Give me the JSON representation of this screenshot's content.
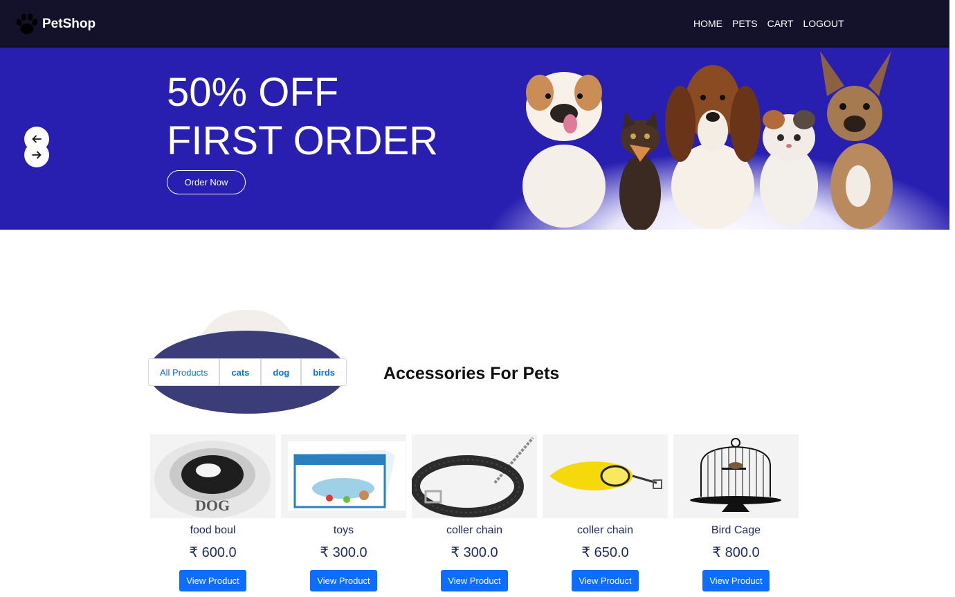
{
  "brand": {
    "name": "PetShop",
    "icon": "paw-icon"
  },
  "nav": {
    "items": [
      {
        "label": "HOME"
      },
      {
        "label": "PETS"
      },
      {
        "label": "CART"
      },
      {
        "label": "LOGOUT"
      }
    ]
  },
  "hero": {
    "line1": "50% OFF",
    "line2": "FIRST ORDER",
    "cta": "Order Now",
    "bg_color": "#281fb0"
  },
  "filters": {
    "items": [
      {
        "label": "All Products"
      },
      {
        "label": "cats"
      },
      {
        "label": "dog"
      },
      {
        "label": "birds"
      }
    ]
  },
  "section": {
    "title": "Accessories For Pets"
  },
  "currency": "₹",
  "products": [
    {
      "name": "food boul",
      "price": "₹ 600.0",
      "button": "View Product",
      "icon": "food-bowl-icon"
    },
    {
      "name": "toys",
      "price": "₹ 300.0",
      "button": "View Product",
      "icon": "toy-box-icon"
    },
    {
      "name": "coller chain",
      "price": "₹ 300.0",
      "button": "View Product",
      "icon": "collar-icon"
    },
    {
      "name": "coller chain",
      "price": "₹ 650.0",
      "button": "View Product",
      "icon": "leash-icon"
    },
    {
      "name": "Bird Cage",
      "price": "₹ 800.0",
      "button": "View Product",
      "icon": "bird-cage-icon"
    }
  ],
  "colors": {
    "navbar": "#14122b",
    "accent": "#0d6efd",
    "text": "#1d2a5c"
  }
}
